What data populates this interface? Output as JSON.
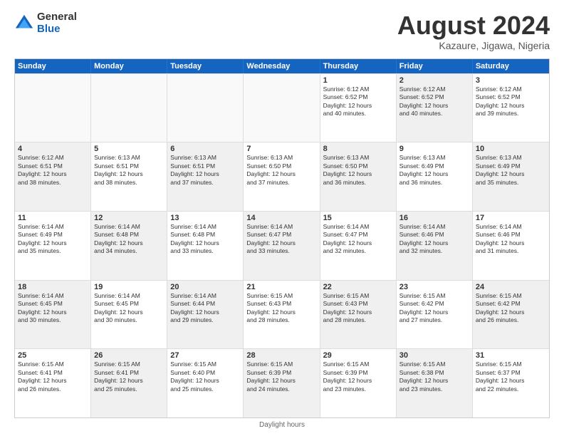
{
  "logo": {
    "general": "General",
    "blue": "Blue"
  },
  "title": "August 2024",
  "subtitle": "Kazaure, Jigawa, Nigeria",
  "headers": [
    "Sunday",
    "Monday",
    "Tuesday",
    "Wednesday",
    "Thursday",
    "Friday",
    "Saturday"
  ],
  "footer": "Daylight hours",
  "rows": [
    [
      {
        "day": "",
        "info": "",
        "empty": true
      },
      {
        "day": "",
        "info": "",
        "empty": true
      },
      {
        "day": "",
        "info": "",
        "empty": true
      },
      {
        "day": "",
        "info": "",
        "empty": true
      },
      {
        "day": "1",
        "info": "Sunrise: 6:12 AM\nSunset: 6:52 PM\nDaylight: 12 hours\nand 40 minutes.",
        "shaded": false
      },
      {
        "day": "2",
        "info": "Sunrise: 6:12 AM\nSunset: 6:52 PM\nDaylight: 12 hours\nand 40 minutes.",
        "shaded": true
      },
      {
        "day": "3",
        "info": "Sunrise: 6:12 AM\nSunset: 6:52 PM\nDaylight: 12 hours\nand 39 minutes.",
        "shaded": false
      }
    ],
    [
      {
        "day": "4",
        "info": "Sunrise: 6:12 AM\nSunset: 6:51 PM\nDaylight: 12 hours\nand 38 minutes.",
        "shaded": true
      },
      {
        "day": "5",
        "info": "Sunrise: 6:13 AM\nSunset: 6:51 PM\nDaylight: 12 hours\nand 38 minutes.",
        "shaded": false
      },
      {
        "day": "6",
        "info": "Sunrise: 6:13 AM\nSunset: 6:51 PM\nDaylight: 12 hours\nand 37 minutes.",
        "shaded": true
      },
      {
        "day": "7",
        "info": "Sunrise: 6:13 AM\nSunset: 6:50 PM\nDaylight: 12 hours\nand 37 minutes.",
        "shaded": false
      },
      {
        "day": "8",
        "info": "Sunrise: 6:13 AM\nSunset: 6:50 PM\nDaylight: 12 hours\nand 36 minutes.",
        "shaded": true
      },
      {
        "day": "9",
        "info": "Sunrise: 6:13 AM\nSunset: 6:49 PM\nDaylight: 12 hours\nand 36 minutes.",
        "shaded": false
      },
      {
        "day": "10",
        "info": "Sunrise: 6:13 AM\nSunset: 6:49 PM\nDaylight: 12 hours\nand 35 minutes.",
        "shaded": true
      }
    ],
    [
      {
        "day": "11",
        "info": "Sunrise: 6:14 AM\nSunset: 6:49 PM\nDaylight: 12 hours\nand 35 minutes.",
        "shaded": false
      },
      {
        "day": "12",
        "info": "Sunrise: 6:14 AM\nSunset: 6:48 PM\nDaylight: 12 hours\nand 34 minutes.",
        "shaded": true
      },
      {
        "day": "13",
        "info": "Sunrise: 6:14 AM\nSunset: 6:48 PM\nDaylight: 12 hours\nand 33 minutes.",
        "shaded": false
      },
      {
        "day": "14",
        "info": "Sunrise: 6:14 AM\nSunset: 6:47 PM\nDaylight: 12 hours\nand 33 minutes.",
        "shaded": true
      },
      {
        "day": "15",
        "info": "Sunrise: 6:14 AM\nSunset: 6:47 PM\nDaylight: 12 hours\nand 32 minutes.",
        "shaded": false
      },
      {
        "day": "16",
        "info": "Sunrise: 6:14 AM\nSunset: 6:46 PM\nDaylight: 12 hours\nand 32 minutes.",
        "shaded": true
      },
      {
        "day": "17",
        "info": "Sunrise: 6:14 AM\nSunset: 6:46 PM\nDaylight: 12 hours\nand 31 minutes.",
        "shaded": false
      }
    ],
    [
      {
        "day": "18",
        "info": "Sunrise: 6:14 AM\nSunset: 6:45 PM\nDaylight: 12 hours\nand 30 minutes.",
        "shaded": true
      },
      {
        "day": "19",
        "info": "Sunrise: 6:14 AM\nSunset: 6:45 PM\nDaylight: 12 hours\nand 30 minutes.",
        "shaded": false
      },
      {
        "day": "20",
        "info": "Sunrise: 6:14 AM\nSunset: 6:44 PM\nDaylight: 12 hours\nand 29 minutes.",
        "shaded": true
      },
      {
        "day": "21",
        "info": "Sunrise: 6:15 AM\nSunset: 6:43 PM\nDaylight: 12 hours\nand 28 minutes.",
        "shaded": false
      },
      {
        "day": "22",
        "info": "Sunrise: 6:15 AM\nSunset: 6:43 PM\nDaylight: 12 hours\nand 28 minutes.",
        "shaded": true
      },
      {
        "day": "23",
        "info": "Sunrise: 6:15 AM\nSunset: 6:42 PM\nDaylight: 12 hours\nand 27 minutes.",
        "shaded": false
      },
      {
        "day": "24",
        "info": "Sunrise: 6:15 AM\nSunset: 6:42 PM\nDaylight: 12 hours\nand 26 minutes.",
        "shaded": true
      }
    ],
    [
      {
        "day": "25",
        "info": "Sunrise: 6:15 AM\nSunset: 6:41 PM\nDaylight: 12 hours\nand 26 minutes.",
        "shaded": false
      },
      {
        "day": "26",
        "info": "Sunrise: 6:15 AM\nSunset: 6:41 PM\nDaylight: 12 hours\nand 25 minutes.",
        "shaded": true
      },
      {
        "day": "27",
        "info": "Sunrise: 6:15 AM\nSunset: 6:40 PM\nDaylight: 12 hours\nand 25 minutes.",
        "shaded": false
      },
      {
        "day": "28",
        "info": "Sunrise: 6:15 AM\nSunset: 6:39 PM\nDaylight: 12 hours\nand 24 minutes.",
        "shaded": true
      },
      {
        "day": "29",
        "info": "Sunrise: 6:15 AM\nSunset: 6:39 PM\nDaylight: 12 hours\nand 23 minutes.",
        "shaded": false
      },
      {
        "day": "30",
        "info": "Sunrise: 6:15 AM\nSunset: 6:38 PM\nDaylight: 12 hours\nand 23 minutes.",
        "shaded": true
      },
      {
        "day": "31",
        "info": "Sunrise: 6:15 AM\nSunset: 6:37 PM\nDaylight: 12 hours\nand 22 minutes.",
        "shaded": false
      }
    ]
  ]
}
